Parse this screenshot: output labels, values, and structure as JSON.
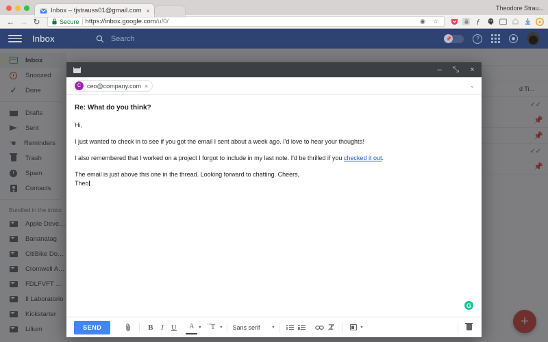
{
  "browser": {
    "tab": {
      "title": "Inbox – tjstrauss01@gmail.com",
      "close": "×"
    },
    "profile_name": "Theodore Strau...",
    "nav": {
      "back": "←",
      "forward": "→",
      "reload": "↻"
    },
    "omnibox": {
      "security_label": "Secure",
      "url_host": "https://inbox.google.com",
      "url_path": "/u/0/",
      "lock_icon": "lock-icon",
      "bookmark_icon": "☆",
      "reader_icon": "◉"
    },
    "extensions": [
      "pocket-icon",
      "lastpass-icon",
      "mathjax-icon",
      "ghostery-icon",
      "window-icon",
      "evernote-icon",
      "download-icon",
      "orange-circle-icon"
    ]
  },
  "appbar": {
    "menu_icon": "hamburger-icon",
    "title": "Inbox",
    "search_icon": "search-icon",
    "search_placeholder": "Search",
    "toggle_icon": "pin-toggle",
    "help_icon": "?",
    "apps_icon": "apps-grid-icon",
    "settings_icon": "settings-icon",
    "avatar": "user-avatar",
    "bg_color": "#2e4372"
  },
  "sidebar": {
    "primary": [
      {
        "label": "Inbox",
        "icon": "inbox-icon",
        "active": true
      },
      {
        "label": "Snoozed",
        "icon": "clock-icon",
        "active": false
      },
      {
        "label": "Done",
        "icon": "check-icon",
        "active": false
      }
    ],
    "secondary": [
      {
        "label": "Drafts",
        "icon": "drafts-icon"
      },
      {
        "label": "Sent",
        "icon": "send-icon"
      },
      {
        "label": "Reminders",
        "icon": "reminder-icon"
      },
      {
        "label": "Trash",
        "icon": "trash-icon"
      },
      {
        "label": "Spam",
        "icon": "spam-icon"
      },
      {
        "label": "Contacts",
        "icon": "contacts-icon"
      }
    ],
    "bundles_header": "Bundled in the inbox",
    "bundles": [
      {
        "label": "Apple Developm",
        "icon": "bundle-icon"
      },
      {
        "label": "Bananatag",
        "icon": "bundle-icon"
      },
      {
        "label": "CitiBike Dock Ale",
        "icon": "bundle-icon"
      },
      {
        "label": "Cromwell Art Wo",
        "icon": "bundle-icon"
      },
      {
        "label": "FDLFVFT Orders",
        "icon": "bundle-icon"
      },
      {
        "label": "Il Laboratorio",
        "icon": "bundle-icon"
      },
      {
        "label": "Kickstarter",
        "icon": "bundle-icon"
      },
      {
        "label": "Lilium",
        "icon": "bundle-icon"
      }
    ]
  },
  "list": {
    "rows": [
      {
        "title": "",
        "action": "none"
      },
      {
        "title": "",
        "action": "none"
      },
      {
        "title": "d Ti...",
        "action": "none"
      },
      {
        "title": "",
        "action": "sweep"
      },
      {
        "title": "",
        "action": "pin"
      },
      {
        "title": "",
        "action": "pin"
      },
      {
        "title": "",
        "action": "sweep"
      },
      {
        "title": "",
        "action": "pin"
      }
    ],
    "compose_fab": "+",
    "fab_color": "#d8453c"
  },
  "compose": {
    "window_icon": "mail-icon",
    "minimize": "–",
    "expand": "⤡",
    "close": "×",
    "recipient": {
      "avatar_letter": "C",
      "email": "ceo@company.com",
      "remove": "×",
      "avatar_color": "#9c27b0"
    },
    "expand_caret": "⌄",
    "subject": "Re: What do you think?",
    "greeting": "Hi,",
    "paragraph_1": "I just wanted to check in to see if you got the email I sent about a week ago. I'd love to hear your thoughts!",
    "paragraph_2_before": "I also remembered that I worked on a project I forgot to include in my last note. I'd be thrilled if you ",
    "paragraph_2_link": "checked it out",
    "paragraph_2_after": ".",
    "paragraph_3": "The email is just above this one in the thread. Looking forward to chatting. Cheers,",
    "signature": "Theo",
    "grammarly_icon": "G",
    "toolbar": {
      "send_label": "SEND",
      "attach_icon": "📎",
      "bold": "B",
      "italic": "I",
      "underline": "U",
      "text_color": "A",
      "font_size": "ᴛᴛ",
      "font_family": "Sans serif",
      "caret": "▾",
      "bullet_list": "bulleted-list-icon",
      "numbered_list": "numbered-list-icon",
      "link": "∞",
      "remove_format": "✗",
      "insert": "insert-icon",
      "discard_icon": "trash-icon"
    }
  }
}
